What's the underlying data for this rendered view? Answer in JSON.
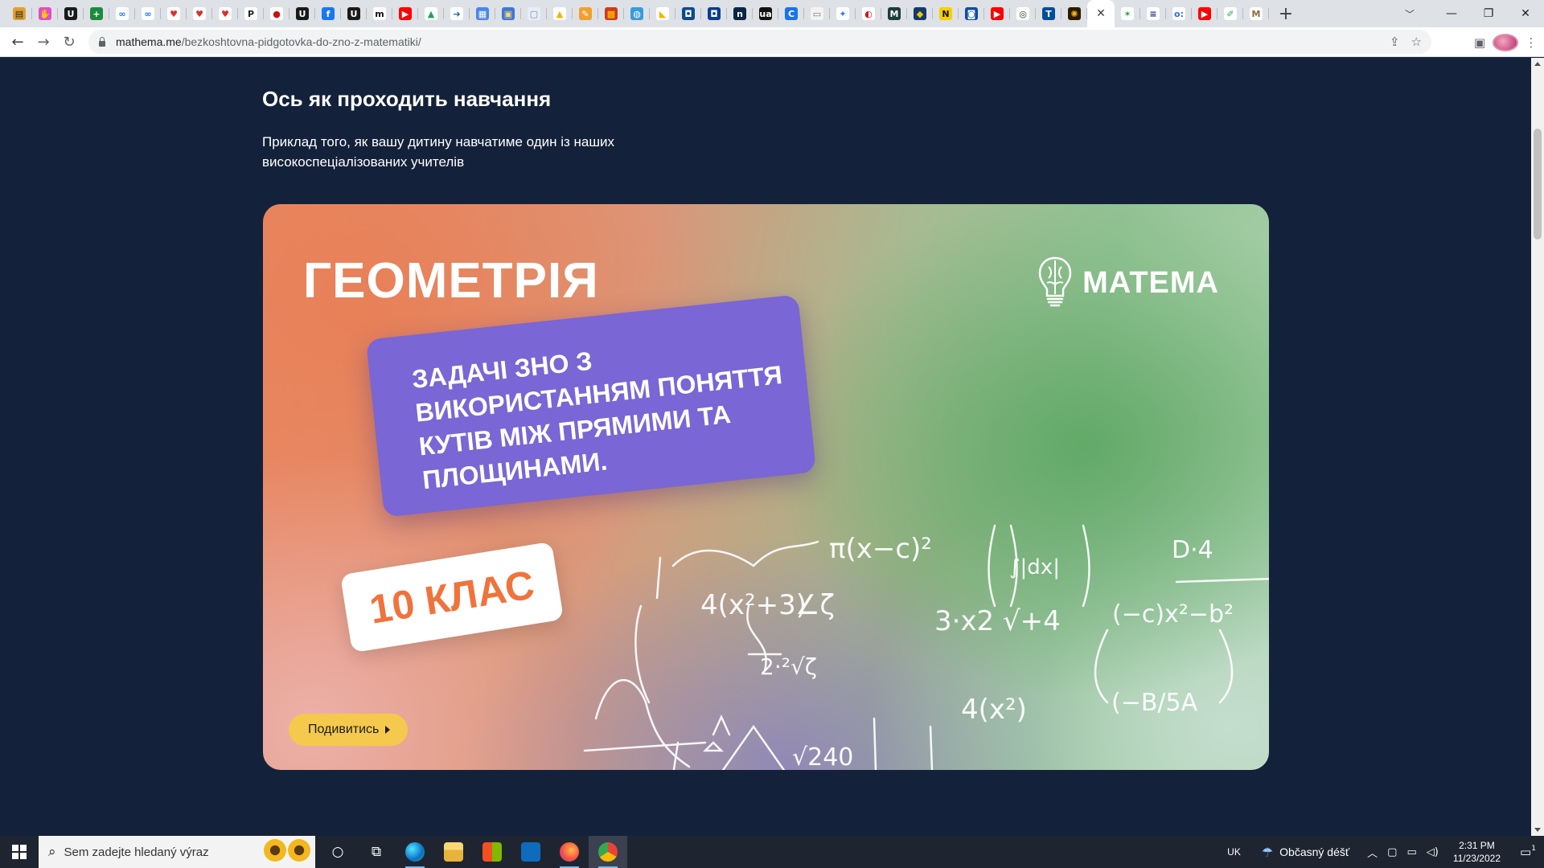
{
  "browser": {
    "tabs": [
      {
        "icon": "shop-icon",
        "glyph": "▤",
        "color": "#e0a030",
        "text_color": "#222"
      },
      {
        "icon": "hand-icon",
        "glyph": "✋",
        "color": "#e14cc8",
        "text_color": "#fff"
      },
      {
        "icon": "u-logo-icon",
        "glyph": "U",
        "color": "#1a1a1a",
        "text_color": "#fff"
      },
      {
        "icon": "plus-green-icon",
        "glyph": "+",
        "color": "#1c8a3c",
        "text_color": "#fff"
      },
      {
        "icon": "meta-icon",
        "glyph": "∞",
        "color": "#ffffff",
        "text_color": "#1877f2"
      },
      {
        "icon": "meta-icon",
        "glyph": "∞",
        "color": "#ffffff",
        "text_color": "#1877f2"
      },
      {
        "icon": "heart-shield-icon",
        "glyph": "♥",
        "color": "#ffffff",
        "text_color": "#d92f2f"
      },
      {
        "icon": "heart-shield-icon",
        "glyph": "♥",
        "color": "#ffffff",
        "text_color": "#d92f2f"
      },
      {
        "icon": "heart-shield-icon",
        "glyph": "♥",
        "color": "#ffffff",
        "text_color": "#d92f2f"
      },
      {
        "icon": "p-logo-icon",
        "glyph": "P",
        "color": "#ffffff",
        "text_color": "#222"
      },
      {
        "icon": "red-dot-icon",
        "glyph": "●",
        "color": "#ffffff",
        "text_color": "#cc1010"
      },
      {
        "icon": "u-logo-icon",
        "glyph": "U",
        "color": "#1a1a1a",
        "text_color": "#fff"
      },
      {
        "icon": "facebook-icon",
        "glyph": "f",
        "color": "#1877f2",
        "text_color": "#fff"
      },
      {
        "icon": "u-logo-icon",
        "glyph": "U",
        "color": "#1a1a1a",
        "text_color": "#fff"
      },
      {
        "icon": "m-italic-icon",
        "glyph": "m",
        "color": "#ffffff",
        "text_color": "#111"
      },
      {
        "icon": "youtube-icon",
        "glyph": "▶",
        "color": "#ff0000",
        "text_color": "#fff"
      },
      {
        "icon": "google-drive-icon",
        "glyph": "▲",
        "color": "#ffffff",
        "text_color": "#1ea362"
      },
      {
        "icon": "arrow-doc-icon",
        "glyph": "➔",
        "color": "#ffffff",
        "text_color": "#1a5fb4"
      },
      {
        "icon": "document-icon",
        "glyph": "▦",
        "color": "#4a86e8",
        "text_color": "#fff"
      },
      {
        "icon": "image-icon",
        "glyph": "▣",
        "color": "#3c78d8",
        "text_color": "#ffd966"
      },
      {
        "icon": "page-icon",
        "glyph": "▢",
        "color": "#e8eef7",
        "text_color": "#6a8ab0"
      },
      {
        "icon": "google-drive-icon",
        "glyph": "▲",
        "color": "#ffffff",
        "text_color": "#f4b400"
      },
      {
        "icon": "pencil-icon",
        "glyph": "✎",
        "color": "#f0a030",
        "text_color": "#fff"
      },
      {
        "icon": "grid-red-icon",
        "glyph": "▩",
        "color": "#cc3c1c",
        "text_color": "#ffcc00"
      },
      {
        "icon": "globe-icon",
        "glyph": "◍",
        "color": "#3a9ad9",
        "text_color": "#fff"
      },
      {
        "icon": "folder-icon",
        "glyph": "◣",
        "color": "#ffffff",
        "text_color": "#f4b400"
      },
      {
        "icon": "blue-box-icon",
        "glyph": "◘",
        "color": "#0b4a8f",
        "text_color": "#fff"
      },
      {
        "icon": "blue-box-icon",
        "glyph": "◘",
        "color": "#0a3d91",
        "text_color": "#fff"
      },
      {
        "icon": "news-icon",
        "glyph": "n",
        "color": "#0b2545",
        "text_color": "#fff"
      },
      {
        "icon": "ua-icon",
        "glyph": "ua",
        "color": "#111111",
        "text_color": "#fff"
      },
      {
        "icon": "c-circle-icon",
        "glyph": "C",
        "color": "#1a73e8",
        "text_color": "#fff"
      },
      {
        "icon": "light-box-icon",
        "glyph": "▭",
        "color": "#f3f3f3",
        "text_color": "#777"
      },
      {
        "icon": "puzzle-icon",
        "glyph": "✦",
        "color": "#ffffff",
        "text_color": "#2f80ed"
      },
      {
        "icon": "cz-flag-icon",
        "glyph": "◐",
        "color": "#ffffff",
        "text_color": "#d7141a"
      },
      {
        "icon": "m-box-icon",
        "glyph": "M",
        "color": "#1d3b3a",
        "text_color": "#fff"
      },
      {
        "icon": "shield-icon",
        "glyph": "◆",
        "color": "#153a6b",
        "text_color": "#f1c40f"
      },
      {
        "icon": "yellow-n-icon",
        "glyph": "N",
        "color": "#f5d000",
        "text_color": "#111"
      },
      {
        "icon": "blue-box-icon",
        "glyph": "◙",
        "color": "#0c4da2",
        "text_color": "#fff"
      },
      {
        "icon": "youtube-icon",
        "glyph": "▶",
        "color": "#ff0000",
        "text_color": "#fff"
      },
      {
        "icon": "ring-icon",
        "glyph": "◎",
        "color": "#ffffff",
        "text_color": "#333"
      },
      {
        "icon": "t-box-icon",
        "glyph": "T",
        "color": "#004d9a",
        "text_color": "#fff"
      },
      {
        "icon": "sun-icon",
        "glyph": "✺",
        "color": "#2b1a00",
        "text_color": "#f2b81d"
      },
      {
        "icon": "close-icon",
        "glyph": "✕",
        "color": "#ffffff",
        "text_color": "#3c4043",
        "active": true
      },
      {
        "icon": "star-man-icon",
        "glyph": "✶",
        "color": "#ffffff",
        "text_color": "#1e9e4a"
      },
      {
        "icon": "list-icon",
        "glyph": "≡",
        "color": "#ffffff",
        "text_color": "#1a3d7c"
      },
      {
        "icon": "od-icon",
        "glyph": "o:",
        "color": "#ffffff",
        "text_color": "#2f6fe4"
      },
      {
        "icon": "youtube-icon",
        "glyph": "▶",
        "color": "#ff0000",
        "text_color": "#fff"
      },
      {
        "icon": "edit-pen-icon",
        "glyph": "✐",
        "color": "#ffffff",
        "text_color": "#2ea44f"
      },
      {
        "icon": "m-serif-icon",
        "glyph": "M",
        "color": "#ffffff",
        "text_color": "#8a6d3b"
      }
    ],
    "url_host": "mathema.me",
    "url_path": "/bezkoshtovna-pidgotovka-do-zno-z-matematiki/"
  },
  "page": {
    "title": "Ось як проходить навчання",
    "subtitle": "Приклад того, як вашу дитину навчатиме один із наших високоспеціалізованих учителів",
    "banner": {
      "subject": "ГЕОМЕТРІЯ",
      "logo": "MATEMA",
      "topic": "ЗАДАЧІ ЗНО З ВИКОРИСТАННЯМ ПОНЯТТЯ КУТІВ МІЖ ПРЯМИМИ ТА ПЛОЩИНАМИ.",
      "grade": "10 КЛАС",
      "play_label": "Подивитись",
      "chalk": [
        "4(x²+3)",
        "∠ζ",
        "π(x−c)²",
        "3·x2 √+4",
        "4(x²)",
        "2·²√ζ",
        "(−B/5A",
        "(−c)x²−b²",
        "D·4",
        "√240",
        "∫|dx|"
      ],
      "colors": {
        "topic_card": "#7a66d4",
        "grade_text": "#f0733c",
        "play_button": "#f5c94d"
      }
    }
  },
  "taskbar": {
    "search_placeholder": "Sem zadejte hledaný výraz",
    "language": "UK",
    "weather": "Občasný déšť",
    "time": "2:31 PM",
    "date": "11/23/2022",
    "notification_count": "1"
  }
}
